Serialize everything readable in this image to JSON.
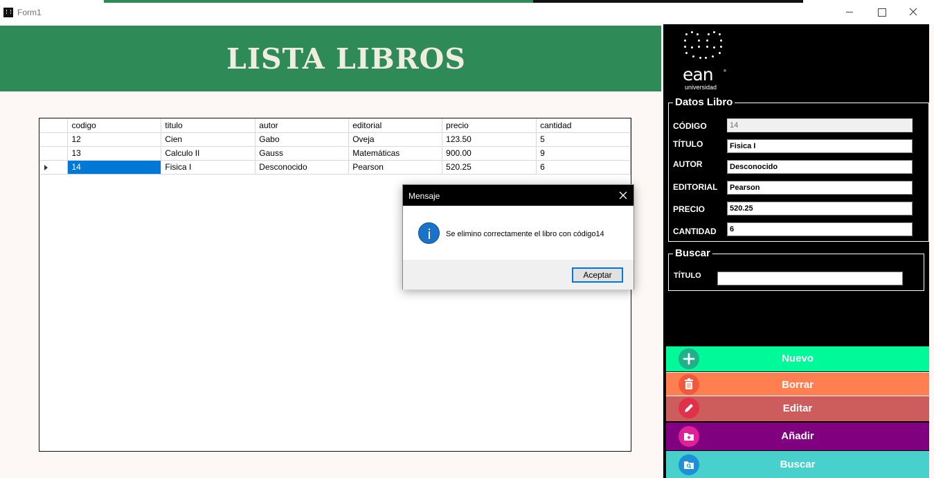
{
  "window": {
    "title": "Form1",
    "controls": {
      "minimize": "minimize-icon",
      "maximize": "maximize-icon",
      "close": "close-icon"
    }
  },
  "header": {
    "title": "LISTA LIBROS",
    "color": "#2e8b57"
  },
  "grid": {
    "columns": [
      "codigo",
      "titulo",
      "autor",
      "editorial",
      "precio",
      "cantidad"
    ],
    "rows": [
      [
        "12",
        "Cien",
        "Gabo",
        "Oveja",
        "123.50",
        "5"
      ],
      [
        "13",
        "Calculo II",
        "Gauss",
        "Matemáticas",
        "900.00",
        "9"
      ],
      [
        "14",
        "Fisica I",
        "Desconocido",
        "Pearson",
        "520.25",
        "6"
      ]
    ],
    "current_row_index": 2
  },
  "logo": {
    "word": "ean",
    "sub": "universidad",
    "reg": "®"
  },
  "datos_libro": {
    "legend": "Datos Libro",
    "codigo_label": "CÓDIGO",
    "codigo_value": "14",
    "titulo_label": "TÍTULO",
    "titulo_value": "Fisica I",
    "autor_label": "AUTOR",
    "autor_value": "Desconocido",
    "editorial_label": "EDITORIAL",
    "editorial_value": "Pearson",
    "precio_label": "PRECIO",
    "precio_value": "520.25",
    "cantidad_label": "CANTIDAD",
    "cantidad_value": "6"
  },
  "buscar": {
    "legend": "Buscar",
    "titulo_label": "TÍTULO",
    "titulo_value": ""
  },
  "actions": [
    {
      "label": "Nuevo",
      "color": "#00fa9a",
      "icon": "plus-icon",
      "icon_color": "#20b08a"
    },
    {
      "label": "Borrar",
      "color": "#ff7f50",
      "icon": "trash-icon",
      "icon_color": "#f05a3c"
    },
    {
      "label": "Editar",
      "color": "#cd5c5c",
      "icon": "pencil-icon",
      "icon_color": "#e0304a"
    },
    {
      "label": "Añadir",
      "color": "#800080",
      "icon": "folder-add-icon",
      "icon_color": "#e0209a"
    },
    {
      "label": "Buscar",
      "color": "#48d1cc",
      "icon": "folder-search-icon",
      "icon_color": "#1e90d8"
    }
  ],
  "dialog": {
    "title": "Mensaje",
    "message": "Se elimino correctamente el libro con código14",
    "ok_label": "Aceptar",
    "icon": "info-icon"
  }
}
